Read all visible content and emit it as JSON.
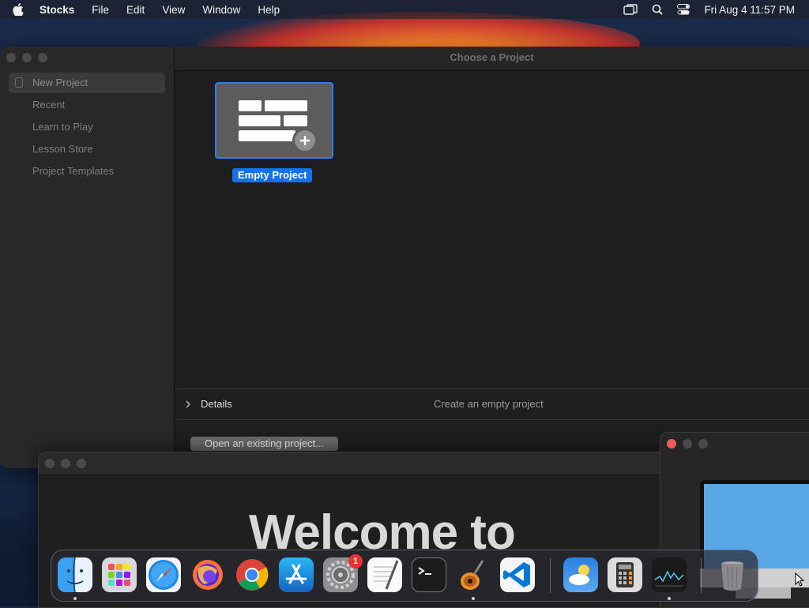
{
  "menubar": {
    "app_name": "Stocks",
    "menus": [
      "File",
      "Edit",
      "View",
      "Window",
      "Help"
    ],
    "clock": "Fri Aug 4  11:57 PM"
  },
  "sidebar": {
    "items": [
      {
        "label": "New Project"
      },
      {
        "label": "Recent"
      },
      {
        "label": "Learn to Play"
      },
      {
        "label": "Lesson Store"
      },
      {
        "label": "Project Templates"
      }
    ]
  },
  "main": {
    "title": "Choose a Project",
    "tile_label": "Empty Project",
    "details_label": "Details",
    "details_desc": "Create an empty project",
    "open_button": "Open an existing project..."
  },
  "welcome": {
    "heading": "Welcome to"
  },
  "dock": {
    "badge_count": "1",
    "apps": [
      {
        "name": "finder-icon"
      },
      {
        "name": "launchpad-icon"
      },
      {
        "name": "safari-icon"
      },
      {
        "name": "firefox-icon"
      },
      {
        "name": "chrome-icon"
      },
      {
        "name": "app-store-icon"
      },
      {
        "name": "system-settings-icon"
      },
      {
        "name": "textedit-icon"
      },
      {
        "name": "terminal-icon"
      },
      {
        "name": "garageband-icon"
      },
      {
        "name": "vscode-icon"
      },
      {
        "name": "weather-icon"
      },
      {
        "name": "calculator-icon"
      },
      {
        "name": "stocks-icon"
      },
      {
        "name": "trash-icon"
      }
    ]
  },
  "colors": {
    "accent": "#1870e6",
    "selection_border": "#2f7df6",
    "badge": "#e8332e"
  }
}
